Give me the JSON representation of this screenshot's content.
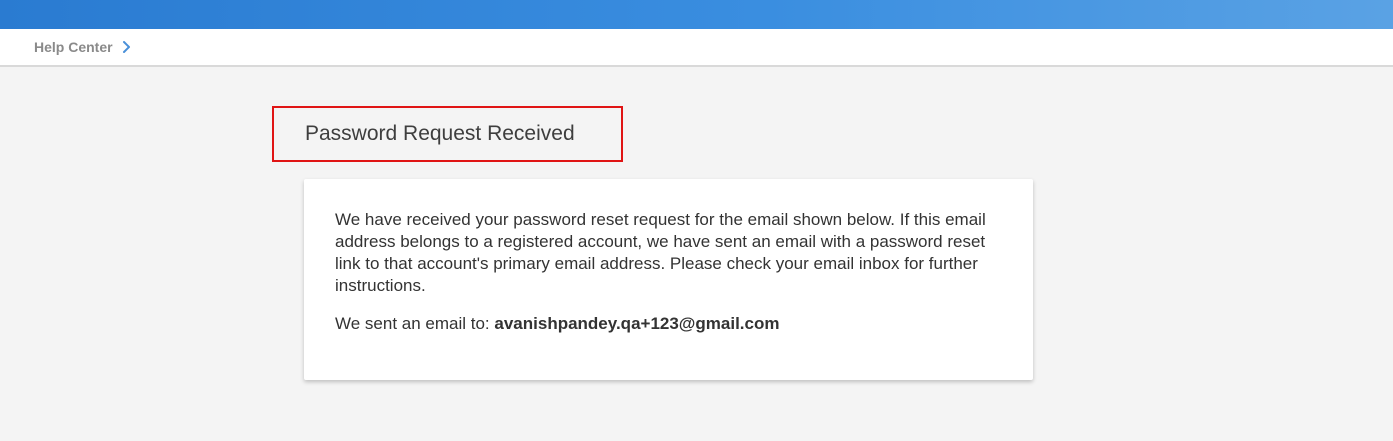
{
  "header": {
    "accent_color": "#2a7bd1"
  },
  "breadcrumb": {
    "items": [
      {
        "label": "Help Center",
        "icon": "chevron-right-icon"
      }
    ]
  },
  "page": {
    "title": "Password Request Received",
    "highlight_color": "#e01414"
  },
  "card": {
    "message": "We have received your password reset request for the email shown below. If this email address belongs to a registered account, we have sent an email with a password reset link to that account's primary email address. Please check your email inbox for further instructions.",
    "sent_prefix": "We sent an email to:",
    "email": "avanishpandey.qa+123@gmail.com"
  }
}
